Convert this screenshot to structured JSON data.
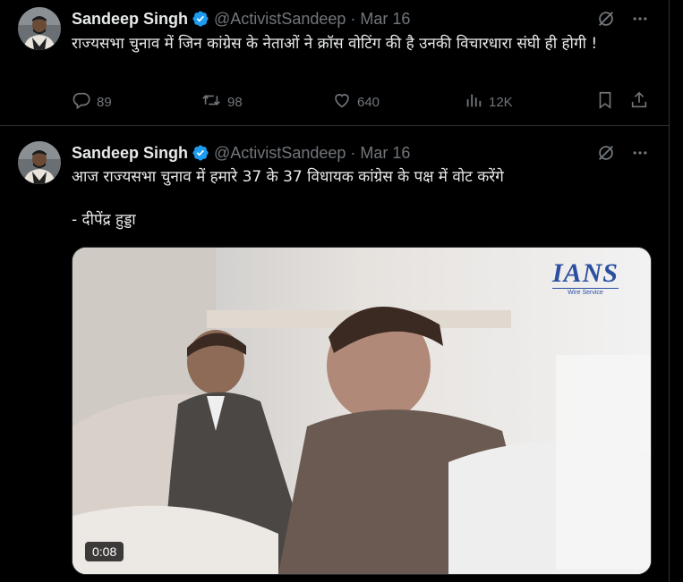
{
  "tweets": [
    {
      "author": {
        "display_name": "Sandeep Singh",
        "handle": "@ActivistSandeep",
        "verified": true
      },
      "separator": "·",
      "date": "Mar 16",
      "text": "राज्यसभा चुनाव में जिन कांग्रेस के नेताओं ने क्रॉस वोटिंग की है उनकी विचारधारा संघी ही होगी !",
      "metrics": {
        "replies": "89",
        "reposts": "98",
        "likes": "640",
        "views": "12K"
      }
    },
    {
      "author": {
        "display_name": "Sandeep Singh",
        "handle": "@ActivistSandeep",
        "verified": true
      },
      "separator": "·",
      "date": "Mar 16",
      "text": "आज राज्यसभा चुनाव में हमारे 37 के 37 विधायक कांग्रेस के पक्ष में वोट करेंगे\n\n- दीपेंद्र हुड्डा",
      "media": {
        "type": "video",
        "duration": "0:08",
        "watermark": "IANS",
        "watermark_sub": "Wire Service"
      }
    }
  ],
  "icons": {
    "verified": "verified-badge-icon",
    "grok": "grok-icon",
    "more": "more-icon",
    "reply": "reply-icon",
    "repost": "repost-icon",
    "like": "like-icon",
    "views": "views-icon",
    "bookmark": "bookmark-icon",
    "share": "share-icon"
  },
  "colors": {
    "background": "#000000",
    "text": "#e7e9ea",
    "secondary": "#71767b",
    "verified": "#1d9bf0",
    "border": "#2f3336"
  }
}
